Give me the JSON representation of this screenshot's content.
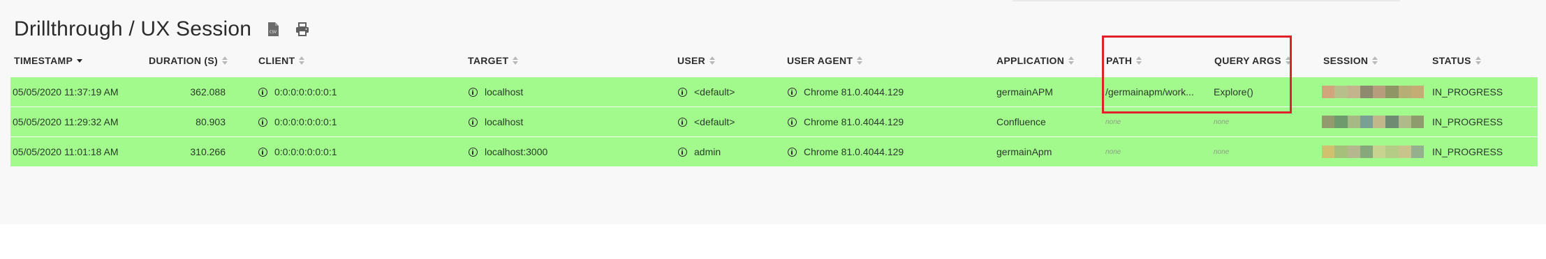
{
  "page": {
    "title": "Drillthrough / UX Session",
    "toolbar": {
      "csv_icon": "csv-file-icon",
      "print_icon": "printer-icon"
    }
  },
  "table": {
    "columns": [
      {
        "key": "timestamp",
        "label": "TIMESTAMP",
        "sort": "descending"
      },
      {
        "key": "duration",
        "label": "DURATION (S)",
        "sort": "none"
      },
      {
        "key": "client",
        "label": "CLIENT",
        "sort": "none"
      },
      {
        "key": "target",
        "label": "TARGET",
        "sort": "none"
      },
      {
        "key": "user",
        "label": "USER",
        "sort": "none"
      },
      {
        "key": "user_agent",
        "label": "USER AGENT",
        "sort": "none"
      },
      {
        "key": "application",
        "label": "APPLICATION",
        "sort": "none"
      },
      {
        "key": "path",
        "label": "PATH",
        "sort": "none"
      },
      {
        "key": "query_args",
        "label": "QUERY ARGS",
        "sort": "none"
      },
      {
        "key": "session",
        "label": "SESSION",
        "sort": "none"
      },
      {
        "key": "status",
        "label": "STATUS",
        "sort": "none"
      }
    ],
    "rows": [
      {
        "timestamp": "05/05/2020 11:37:19 AM",
        "duration": "362.088",
        "client": "0:0:0:0:0:0:0:1",
        "target": "localhost",
        "user": "<default>",
        "user_agent": "Chrome 81.0.4044.129",
        "application": "germainAPM",
        "path": "/germainapm/work...",
        "query_args": "Explore()",
        "status": "IN_PROGRESS",
        "session_colors": [
          "#d2a57d",
          "#b7bf8a",
          "#c2b48d",
          "#8d8a6f",
          "#b79d7c",
          "#8f9565",
          "#b7ae76",
          "#c5ac74"
        ]
      },
      {
        "timestamp": "05/05/2020 11:29:32 AM",
        "duration": "80.903",
        "client": "0:0:0:0:0:0:0:1",
        "target": "localhost",
        "user": "<default>",
        "user_agent": "Chrome 81.0.4044.129",
        "application": "Confluence",
        "path": "none",
        "query_args": "none",
        "status": "IN_PROGRESS",
        "session_colors": [
          "#939a6d",
          "#6f9a6e",
          "#a6b985",
          "#7a9f94",
          "#c2b68b",
          "#6f8c73",
          "#b0b98a",
          "#8d9b6d"
        ]
      },
      {
        "timestamp": "05/05/2020 11:01:18 AM",
        "duration": "310.266",
        "client": "0:0:0:0:0:0:0:1",
        "target": "localhost:3000",
        "user": "admin",
        "user_agent": "Chrome 81.0.4044.129",
        "application": "germainApm",
        "path": "none",
        "query_args": "none",
        "status": "IN_PROGRESS",
        "session_colors": [
          "#d1c16e",
          "#a6c07b",
          "#b5b78e",
          "#86a87b",
          "#c7d38f",
          "#b4cc86",
          "#c9c38c",
          "#94b08f"
        ]
      }
    ]
  },
  "colors": {
    "row_bg": "#a2fa8c",
    "highlight_border": "#e0202a",
    "page_bg": "#f8f8f9"
  }
}
